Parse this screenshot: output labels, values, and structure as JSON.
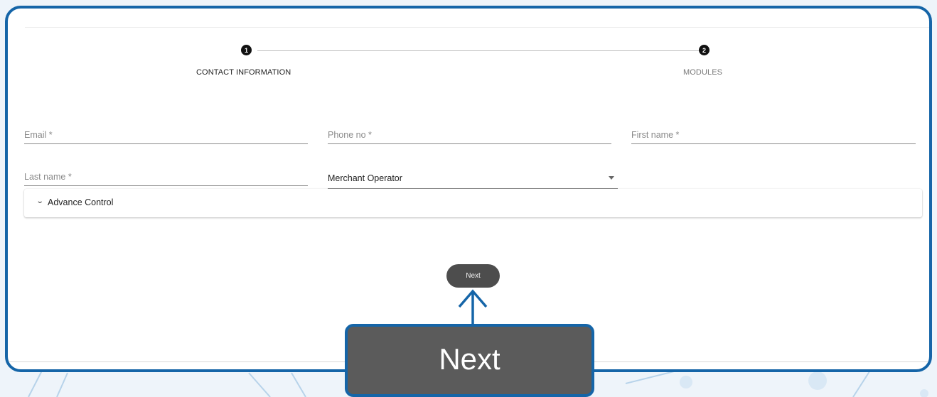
{
  "stepper": {
    "steps": [
      {
        "number": "1",
        "label": "CONTACT INFORMATION"
      },
      {
        "number": "2",
        "label": "MODULES"
      }
    ]
  },
  "form": {
    "email_placeholder": "Email *",
    "phone_placeholder": "Phone no *",
    "first_name_placeholder": "First name *",
    "last_name_placeholder": "Last name *",
    "role_value": "Merchant Operator"
  },
  "accordion": {
    "label": "Advance Control"
  },
  "actions": {
    "next_label": "Next"
  },
  "callout": {
    "label": "Next"
  },
  "colors": {
    "frame_border": "#1565a8",
    "button": "#4d4d4d",
    "callout_fill": "#5b5b5b"
  }
}
